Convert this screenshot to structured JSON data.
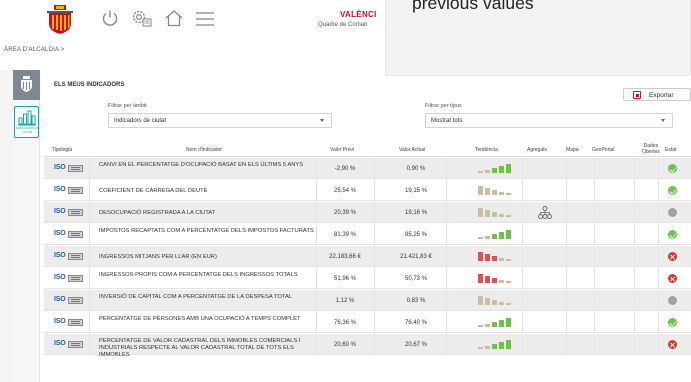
{
  "header": {
    "city_name": "VALÈNCI",
    "city_sub": "Quadre de Coman"
  },
  "breadcrumb": "ÀREA D'ALCALDIA  >",
  "tooltip": {
    "text": "previous values"
  },
  "sidebar": {
    "active_label": "INDICADORS DE CIUTAT"
  },
  "panel": {
    "title": "ELS MEUS INDICADORS",
    "export_label": "Exportar",
    "filter_scope_label": "Filtrar per àmbit",
    "filter_scope_value": "Indicadors de ciutat",
    "filter_type_label": "Filtrar per tipus",
    "filter_type_value": "Mostrat tots"
  },
  "table": {
    "headers": {
      "tipologia": "Tipologia",
      "nom": "Nom d'indicador",
      "previ": "Valor Previ",
      "actual": "Valor Actual",
      "tendencia": "Tendència",
      "agregats": "Agregats",
      "mapa": "Mapa",
      "geoportal": "GeoPortal",
      "dades_l1": "Dades",
      "dades_l2": "Obertes",
      "estat": "Estat"
    },
    "iso_label": "ISO",
    "rows": [
      {
        "name": "CANVI EN EL PERCENTATGE D'OCUPACIÓ BASAT EN ELS ÚLTIMS 5 ANYS",
        "prev": "-2,90 %",
        "curr": "0,90 %",
        "trend": "up",
        "aggregate": false,
        "status": "ok"
      },
      {
        "name": "COEFICIENT DE CÀRREGA DEL DEUTE",
        "prev": "25,54 %",
        "curr": "19,15 %",
        "trend": "down",
        "aggregate": false,
        "status": "ok"
      },
      {
        "name": "DESOCUPACIÓ REGISTRADA A LA CIUTAT",
        "prev": "20,39 %",
        "curr": "19,16 %",
        "trend": "down",
        "aggregate": true,
        "status": "neutral"
      },
      {
        "name": "IMPOSTOS RECAPTATS COM A PERCENTATGE DELS IMPOSTOS FACTURATS",
        "prev": "81,39 %",
        "curr": "85,25 %",
        "trend": "up",
        "aggregate": false,
        "status": "ok"
      },
      {
        "name": "INGRESSOS MITJANS PER LLAR (EN EUR)",
        "prev": "22.183,66 €",
        "curr": "21.421,83 €",
        "trend": "down-red",
        "aggregate": false,
        "status": "bad"
      },
      {
        "name": "INGRESSOS PROPIS COM A PERCENTATGE DELS INGRESSOS TOTALS",
        "prev": "51,96 %",
        "curr": "50,73 %",
        "trend": "down-red",
        "aggregate": false,
        "status": "bad"
      },
      {
        "name": "INVERSIÓ DE CAPITAL COM A PERCENTATGE DE LA DESPESA TOTAL",
        "prev": "1,12 %",
        "curr": "0,83 %",
        "trend": "down",
        "aggregate": false,
        "status": "neutral"
      },
      {
        "name": "PERCENTATGE DE PERSONES AMB UNA OCUPACIÓ A TEMPS COMPLET",
        "prev": "76,36 %",
        "curr": "76,40 %",
        "trend": "up",
        "aggregate": false,
        "status": "ok"
      },
      {
        "name": "PERCENTATGE DE VALOR CADASTRAL DELS IMMOBLES COMERCIALS I INDUSTRIALS RESPECTE AL VALOR CADASTRAL TOTAL DE TOTS ELS IMMOBLES",
        "prev": "20,60 %",
        "curr": "20,67 %",
        "trend": "up",
        "aggregate": false,
        "status": "bad"
      }
    ]
  },
  "colors": {
    "brand_red": "#c8102e",
    "accent_teal": "#0fa9a0",
    "trend_green": "#6cc24a",
    "trend_tan": "#c9bfa0",
    "trend_red": "#d9534f"
  }
}
